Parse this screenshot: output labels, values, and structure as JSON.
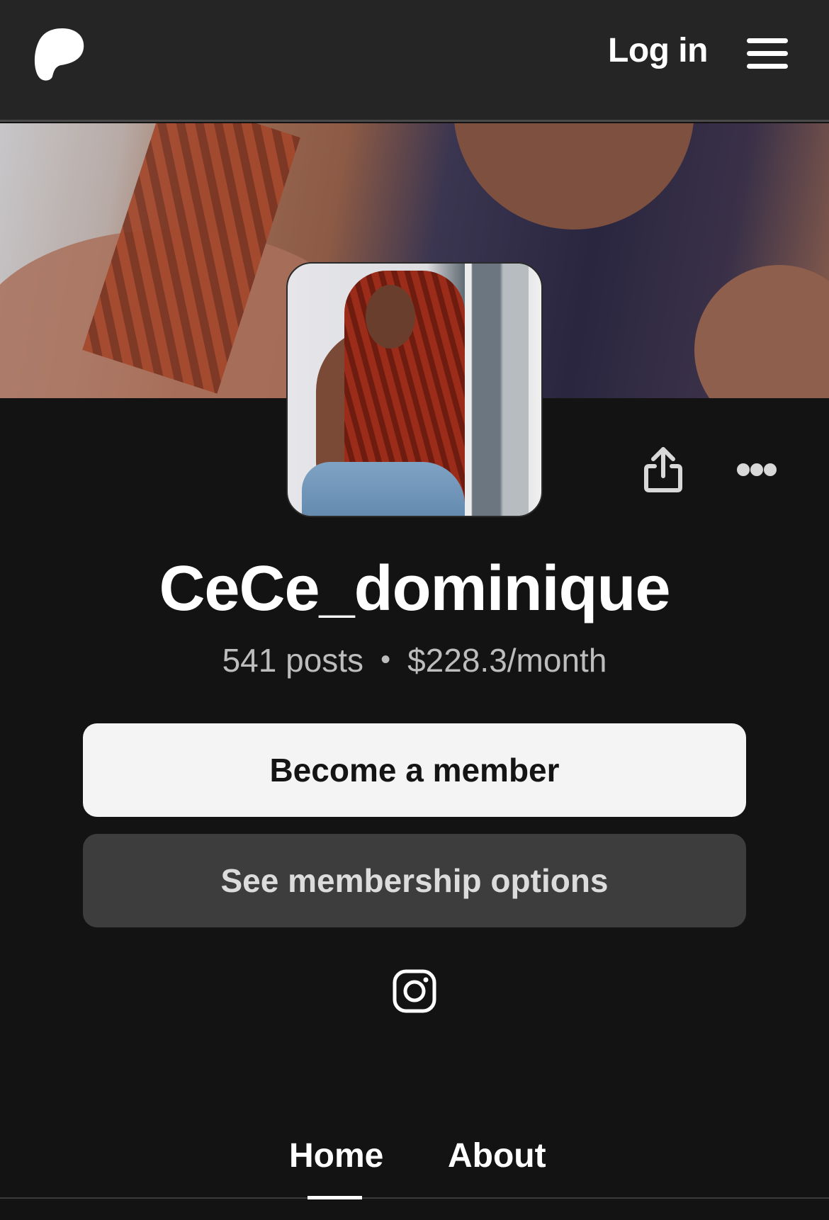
{
  "header": {
    "logo_icon": "patreon-logo-icon",
    "login_label": "Log in",
    "menu_icon": "hamburger-menu-icon"
  },
  "profile": {
    "banner_image": "cover-photo",
    "avatar_image": "profile-photo",
    "name": "CeCe_dominique",
    "posts": "541 posts",
    "separator": "•",
    "earnings": "$228.3/month",
    "share_icon": "share-icon",
    "more_icon": "more-options-icon"
  },
  "actions": {
    "become_member_label": "Become a member",
    "membership_options_label": "See membership options"
  },
  "social": {
    "instagram_icon": "instagram-icon"
  },
  "tabs": [
    {
      "label": "Home",
      "active": true
    },
    {
      "label": "About",
      "active": false
    }
  ],
  "colors": {
    "page_bg": "#131313",
    "header_bg": "#252525",
    "primary_button_bg": "#f4f4f4",
    "secondary_button_bg": "#3d3d3d"
  }
}
